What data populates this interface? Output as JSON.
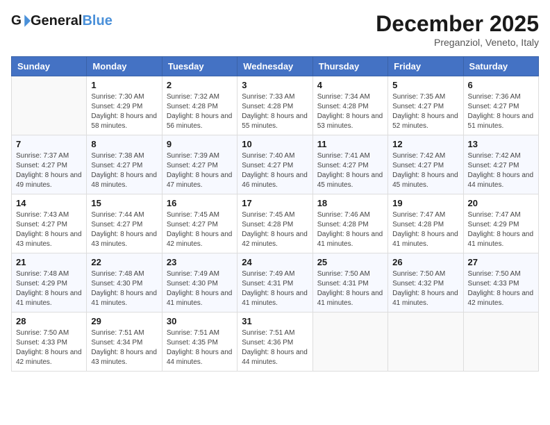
{
  "header": {
    "logo_general": "General",
    "logo_blue": "Blue",
    "month": "December 2025",
    "location": "Preganziol, Veneto, Italy"
  },
  "weekdays": [
    "Sunday",
    "Monday",
    "Tuesday",
    "Wednesday",
    "Thursday",
    "Friday",
    "Saturday"
  ],
  "weeks": [
    [
      {
        "day": "",
        "sunrise": "",
        "sunset": "",
        "daylight": ""
      },
      {
        "day": "1",
        "sunrise": "Sunrise: 7:30 AM",
        "sunset": "Sunset: 4:29 PM",
        "daylight": "Daylight: 8 hours and 58 minutes."
      },
      {
        "day": "2",
        "sunrise": "Sunrise: 7:32 AM",
        "sunset": "Sunset: 4:28 PM",
        "daylight": "Daylight: 8 hours and 56 minutes."
      },
      {
        "day": "3",
        "sunrise": "Sunrise: 7:33 AM",
        "sunset": "Sunset: 4:28 PM",
        "daylight": "Daylight: 8 hours and 55 minutes."
      },
      {
        "day": "4",
        "sunrise": "Sunrise: 7:34 AM",
        "sunset": "Sunset: 4:28 PM",
        "daylight": "Daylight: 8 hours and 53 minutes."
      },
      {
        "day": "5",
        "sunrise": "Sunrise: 7:35 AM",
        "sunset": "Sunset: 4:27 PM",
        "daylight": "Daylight: 8 hours and 52 minutes."
      },
      {
        "day": "6",
        "sunrise": "Sunrise: 7:36 AM",
        "sunset": "Sunset: 4:27 PM",
        "daylight": "Daylight: 8 hours and 51 minutes."
      }
    ],
    [
      {
        "day": "7",
        "sunrise": "Sunrise: 7:37 AM",
        "sunset": "Sunset: 4:27 PM",
        "daylight": "Daylight: 8 hours and 49 minutes."
      },
      {
        "day": "8",
        "sunrise": "Sunrise: 7:38 AM",
        "sunset": "Sunset: 4:27 PM",
        "daylight": "Daylight: 8 hours and 48 minutes."
      },
      {
        "day": "9",
        "sunrise": "Sunrise: 7:39 AM",
        "sunset": "Sunset: 4:27 PM",
        "daylight": "Daylight: 8 hours and 47 minutes."
      },
      {
        "day": "10",
        "sunrise": "Sunrise: 7:40 AM",
        "sunset": "Sunset: 4:27 PM",
        "daylight": "Daylight: 8 hours and 46 minutes."
      },
      {
        "day": "11",
        "sunrise": "Sunrise: 7:41 AM",
        "sunset": "Sunset: 4:27 PM",
        "daylight": "Daylight: 8 hours and 45 minutes."
      },
      {
        "day": "12",
        "sunrise": "Sunrise: 7:42 AM",
        "sunset": "Sunset: 4:27 PM",
        "daylight": "Daylight: 8 hours and 45 minutes."
      },
      {
        "day": "13",
        "sunrise": "Sunrise: 7:42 AM",
        "sunset": "Sunset: 4:27 PM",
        "daylight": "Daylight: 8 hours and 44 minutes."
      }
    ],
    [
      {
        "day": "14",
        "sunrise": "Sunrise: 7:43 AM",
        "sunset": "Sunset: 4:27 PM",
        "daylight": "Daylight: 8 hours and 43 minutes."
      },
      {
        "day": "15",
        "sunrise": "Sunrise: 7:44 AM",
        "sunset": "Sunset: 4:27 PM",
        "daylight": "Daylight: 8 hours and 43 minutes."
      },
      {
        "day": "16",
        "sunrise": "Sunrise: 7:45 AM",
        "sunset": "Sunset: 4:27 PM",
        "daylight": "Daylight: 8 hours and 42 minutes."
      },
      {
        "day": "17",
        "sunrise": "Sunrise: 7:45 AM",
        "sunset": "Sunset: 4:28 PM",
        "daylight": "Daylight: 8 hours and 42 minutes."
      },
      {
        "day": "18",
        "sunrise": "Sunrise: 7:46 AM",
        "sunset": "Sunset: 4:28 PM",
        "daylight": "Daylight: 8 hours and 41 minutes."
      },
      {
        "day": "19",
        "sunrise": "Sunrise: 7:47 AM",
        "sunset": "Sunset: 4:28 PM",
        "daylight": "Daylight: 8 hours and 41 minutes."
      },
      {
        "day": "20",
        "sunrise": "Sunrise: 7:47 AM",
        "sunset": "Sunset: 4:29 PM",
        "daylight": "Daylight: 8 hours and 41 minutes."
      }
    ],
    [
      {
        "day": "21",
        "sunrise": "Sunrise: 7:48 AM",
        "sunset": "Sunset: 4:29 PM",
        "daylight": "Daylight: 8 hours and 41 minutes."
      },
      {
        "day": "22",
        "sunrise": "Sunrise: 7:48 AM",
        "sunset": "Sunset: 4:30 PM",
        "daylight": "Daylight: 8 hours and 41 minutes."
      },
      {
        "day": "23",
        "sunrise": "Sunrise: 7:49 AM",
        "sunset": "Sunset: 4:30 PM",
        "daylight": "Daylight: 8 hours and 41 minutes."
      },
      {
        "day": "24",
        "sunrise": "Sunrise: 7:49 AM",
        "sunset": "Sunset: 4:31 PM",
        "daylight": "Daylight: 8 hours and 41 minutes."
      },
      {
        "day": "25",
        "sunrise": "Sunrise: 7:50 AM",
        "sunset": "Sunset: 4:31 PM",
        "daylight": "Daylight: 8 hours and 41 minutes."
      },
      {
        "day": "26",
        "sunrise": "Sunrise: 7:50 AM",
        "sunset": "Sunset: 4:32 PM",
        "daylight": "Daylight: 8 hours and 41 minutes."
      },
      {
        "day": "27",
        "sunrise": "Sunrise: 7:50 AM",
        "sunset": "Sunset: 4:33 PM",
        "daylight": "Daylight: 8 hours and 42 minutes."
      }
    ],
    [
      {
        "day": "28",
        "sunrise": "Sunrise: 7:50 AM",
        "sunset": "Sunset: 4:33 PM",
        "daylight": "Daylight: 8 hours and 42 minutes."
      },
      {
        "day": "29",
        "sunrise": "Sunrise: 7:51 AM",
        "sunset": "Sunset: 4:34 PM",
        "daylight": "Daylight: 8 hours and 43 minutes."
      },
      {
        "day": "30",
        "sunrise": "Sunrise: 7:51 AM",
        "sunset": "Sunset: 4:35 PM",
        "daylight": "Daylight: 8 hours and 44 minutes."
      },
      {
        "day": "31",
        "sunrise": "Sunrise: 7:51 AM",
        "sunset": "Sunset: 4:36 PM",
        "daylight": "Daylight: 8 hours and 44 minutes."
      },
      {
        "day": "",
        "sunrise": "",
        "sunset": "",
        "daylight": ""
      },
      {
        "day": "",
        "sunrise": "",
        "sunset": "",
        "daylight": ""
      },
      {
        "day": "",
        "sunrise": "",
        "sunset": "",
        "daylight": ""
      }
    ]
  ]
}
